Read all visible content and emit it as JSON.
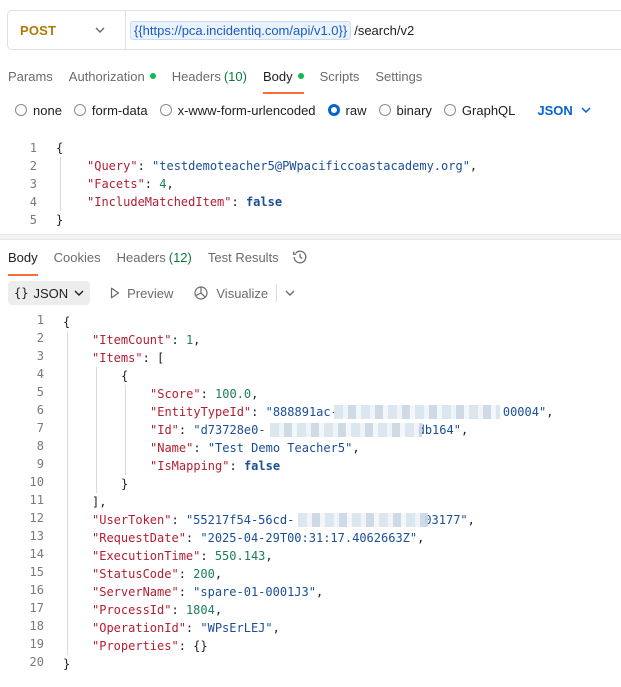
{
  "request": {
    "method": "POST",
    "url_variable": "{{https://pca.incidentiq.com/api/v1.0}}",
    "url_path": "/search/v2"
  },
  "request_tabs": [
    {
      "label": "Params"
    },
    {
      "label": "Authorization"
    },
    {
      "label": "Headers",
      "count": "(10)"
    },
    {
      "label": "Body"
    },
    {
      "label": "Scripts"
    },
    {
      "label": "Settings"
    }
  ],
  "body_types": [
    "none",
    "form-data",
    "x-www-form-urlencoded",
    "raw",
    "binary",
    "GraphQL"
  ],
  "body_format": "JSON",
  "request_body": {
    "line_numbers": [
      "1",
      "2",
      "3",
      "4",
      "5"
    ],
    "open_brace": "{",
    "close_brace": "}",
    "query_key": "\"Query\"",
    "query_value": "\"testdemoteacher5@PWpacificcoastacademy.org\"",
    "facets_key": "\"Facets\"",
    "facets_value": "4",
    "include_key": "\"IncludeMatchedItem\"",
    "include_value": "false"
  },
  "response_tabs": [
    {
      "label": "Body"
    },
    {
      "label": "Cookies"
    },
    {
      "label": "Headers",
      "count": "(12)"
    },
    {
      "label": "Test Results"
    }
  ],
  "response_toolbar": {
    "format_braces": "{}",
    "format_label": "JSON",
    "preview_label": "Preview",
    "visualize_label": "Visualize"
  },
  "response_body": {
    "line_numbers": [
      "1",
      "2",
      "3",
      "4",
      "5",
      "6",
      "7",
      "8",
      "9",
      "10",
      "11",
      "12",
      "13",
      "14",
      "15",
      "16",
      "17",
      "18",
      "19",
      "20"
    ],
    "item_count_key": "\"ItemCount\"",
    "item_count_value": "1",
    "items_key": "\"Items\"",
    "score_key": "\"Score\"",
    "score_value": "100.0",
    "entity_type_key": "\"EntityTypeId\"",
    "entity_type_start": "\"888891ac-",
    "entity_type_end": "00004\"",
    "id_key": "\"Id\"",
    "id_start": "\"d73728e0-",
    "id_end": "db164\"",
    "name_key": "\"Name\"",
    "name_value": "\"Test Demo Teacher5\"",
    "is_mapping_key": "\"IsMapping\"",
    "is_mapping_value": "false",
    "user_token_key": "\"UserToken\"",
    "user_token_start": "\"55217f54-56cd-",
    "user_token_end": "03177\"",
    "request_date_key": "\"RequestDate\"",
    "request_date_value": "\"2025-04-29T00:31:17.4062663Z\"",
    "execution_time_key": "\"ExecutionTime\"",
    "execution_time_value": "550.143",
    "status_code_key": "\"StatusCode\"",
    "status_code_value": "200",
    "server_name_key": "\"ServerName\"",
    "server_name_value": "\"spare-01-0001J3\"",
    "process_id_key": "\"ProcessId\"",
    "process_id_value": "1804",
    "operation_id_key": "\"OperationId\"",
    "operation_id_value": "\"WPsErLEJ\"",
    "properties_key": "\"Properties\"",
    "properties_value": "{}"
  },
  "colors": {
    "method": "#ad7a03",
    "active_tab_underline": "#ff6c37",
    "status_dot": "#0cbb52",
    "link_blue": "#0265d2",
    "json_key": "#b31e33",
    "json_string": "#1a4f96",
    "json_number": "#1a7f5a"
  }
}
